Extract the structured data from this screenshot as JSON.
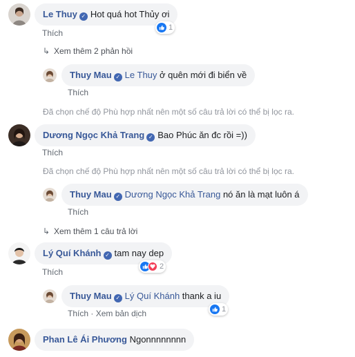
{
  "comments": [
    {
      "author": "Le Thuy",
      "text": "Hot quá hot Thủy ơi",
      "action": "Thích",
      "reaction_count": "1"
    },
    {
      "author": "Dương Ngọc Khả Trang",
      "text": "Bao Phúc ăn đc rồi =))",
      "action": "Thích"
    },
    {
      "author": "Lý Quí Khánh",
      "text": "tam nay dep",
      "action": "Thích",
      "reaction_count": "2"
    },
    {
      "author": "Phan Lê Ái Phương",
      "text": "Ngonnnnnnnn"
    }
  ],
  "replies": [
    {
      "author": "Thuy Mau",
      "mention": "Le Thuy",
      "text": "ở quên mới đi biển về",
      "action": "Thích"
    },
    {
      "author": "Thuy Mau",
      "mention": "Dương Ngọc Khả Trang",
      "text": "nó ăn là mạt luôn á",
      "action": "Thích"
    },
    {
      "author": "Thuy Mau",
      "mention": "Lý Quí Khánh",
      "text": "thank a iu",
      "action": "Thích",
      "translate": "Xem bản dịch",
      "reaction_count": "1"
    }
  ],
  "view_more": [
    "Xem thêm 2 phản hồi",
    "Xem thêm 1 câu trả lời"
  ],
  "filter_notice": "Đã chọn chế độ Phù hợp nhất nên một số câu trả lời có thể bị lọc ra.",
  "separator": "·",
  "colors": {
    "name": "#385898",
    "bubble": "#f2f3f5",
    "like": "#1877f2",
    "love": "#f33e58"
  }
}
